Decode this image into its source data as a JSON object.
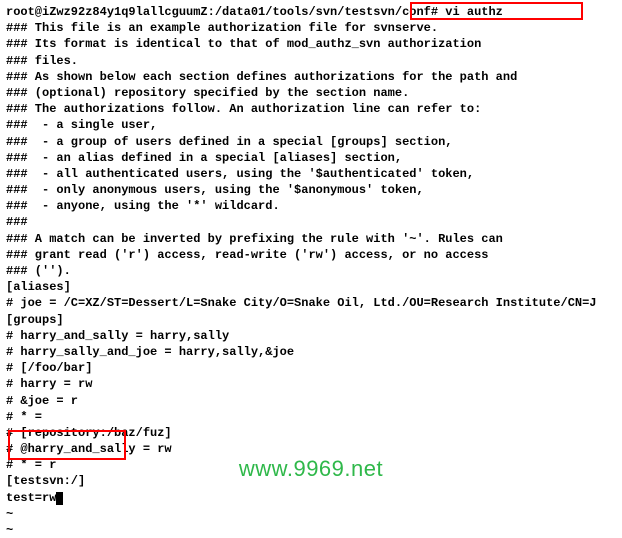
{
  "prompt_line": "root@iZwz92z84y1q9lallcguumZ:/data01/tools/svn/testsvn/conf# vi authz",
  "lines": [
    "### This file is an example authorization file for svnserve.",
    "### Its format is identical to that of mod_authz_svn authorization",
    "### files.",
    "### As shown below each section defines authorizations for the path and",
    "### (optional) repository specified by the section name.",
    "### The authorizations follow. An authorization line can refer to:",
    "###  - a single user,",
    "###  - a group of users defined in a special [groups] section,",
    "###  - an alias defined in a special [aliases] section,",
    "###  - all authenticated users, using the '$authenticated' token,",
    "###  - only anonymous users, using the '$anonymous' token,",
    "###  - anyone, using the '*' wildcard.",
    "###",
    "### A match can be inverted by prefixing the rule with '~'. Rules can",
    "### grant read ('r') access, read-write ('rw') access, or no access",
    "### ('').",
    "",
    "[aliases]",
    "# joe = /C=XZ/ST=Dessert/L=Snake City/O=Snake Oil, Ltd./OU=Research Institute/CN=J",
    "",
    "[groups]",
    "# harry_and_sally = harry,sally",
    "# harry_sally_and_joe = harry,sally,&joe",
    "",
    "# [/foo/bar]",
    "# harry = rw",
    "# &joe = r",
    "# * =",
    "",
    "# [repository:/baz/fuz]",
    "# @harry_and_sally = rw",
    "# * = r",
    ""
  ],
  "edit_section_line1": "[testsvn:/]",
  "edit_section_line2": "test=rw",
  "tilde": "~",
  "watermark": "www.9969.net"
}
